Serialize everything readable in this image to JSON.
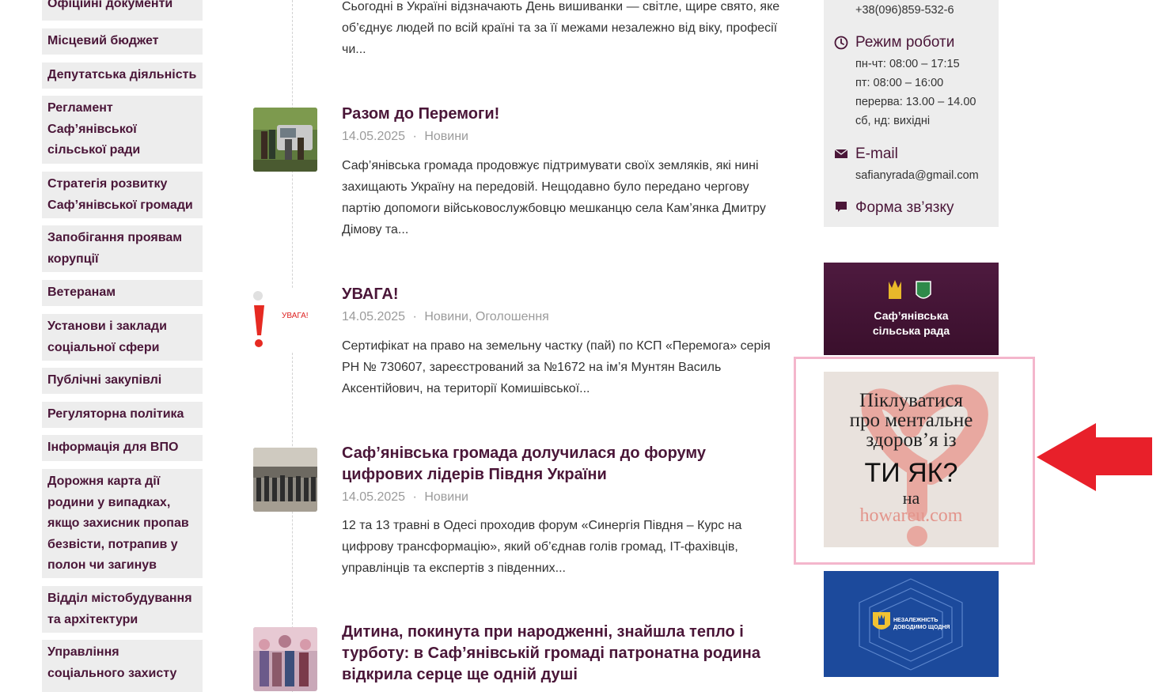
{
  "sidebar": {
    "items": [
      {
        "label": "Офіційні документи"
      },
      {
        "label": "Місцевий бюджет"
      },
      {
        "label": "Депутатська діяльність"
      },
      {
        "label": "Регламент Саф’янівської сільської ради"
      },
      {
        "label": "Стратегія розвитку Саф’янівської громади"
      },
      {
        "label": "Запобігання проявам корупції"
      },
      {
        "label": "Ветеранам"
      },
      {
        "label": "Установи і заклади соціальної сфери"
      },
      {
        "label": "Публічні закупівлі"
      },
      {
        "label": "Регуляторна політика"
      },
      {
        "label": "Інформація для ВПО"
      },
      {
        "label": "Дорожня карта дії родини у випадках, якщо захисник пропав безвісти, потрапив у полон чи загинув"
      },
      {
        "label": "Відділ містобудування та архітектури"
      },
      {
        "label": "Управління соціального захисту"
      }
    ]
  },
  "news": {
    "top_excerpt": "Сьогодні в Україні відзначають День вишиванки — світле, щире свято, яке об’єднує людей по всій країні та за її межами незалежно від віку, професії чи...",
    "items": [
      {
        "title": "Разом до Перемоги!",
        "date": "14.05.2025",
        "sep": "·",
        "categories": "Новини",
        "excerpt": "Саф’янівська громада продовжує підтримувати своїх земляків, які нині захищають Україну на передовій. Нещодавно було передано чергову партію допомоги військовослужбовцю мешканцю села Кам’янка Дмитру Дімову та..."
      },
      {
        "title": "УВАГА!",
        "date": "14.05.2025",
        "sep": "·",
        "categories": "Новини, Оголошення",
        "thumb_text": "УВАГА!",
        "excerpt": "Сертифікат на право на земельну частку (пай) по КСП «Перемога» серія РН № 730607, зареєстрований за №1672 на ім’я Мунтян Василь Аксентійович, на території Комишівської..."
      },
      {
        "title": "Саф’янівська громада долучилася до форуму цифрових лідерів Півдня України",
        "date": "14.05.2025",
        "sep": "·",
        "categories": "Новини",
        "excerpt": "12 та 13 травні в Одесі проходив форум «Синергія Півдня – Курс на цифрову трансформацію», який об’єднав голів громад, IT-фахівців, управлінців та експертів з південних..."
      },
      {
        "title": "Дитина, покинута при народженні, знайшла тепло і турботу: в Саф’янівській громаді патронатна родина відкрила серце ще одній душі"
      }
    ]
  },
  "contacts": {
    "phone": "+38(096)859-532-6",
    "hours_heading": "Режим роботи",
    "hours": [
      "пн-чт: 08:00 – 17:15",
      "пт: 08:00 – 16:00",
      "перерва: 13.00 – 14.00",
      "сб, нд: вихідні"
    ],
    "email_heading": "E-mail",
    "email": "safianyrada@gmail.com",
    "form_heading": "Форма зв’язку",
    "icons": {
      "hours": "clock-icon",
      "email": "envelope-icon",
      "form": "chat-bubble-icon"
    }
  },
  "banners": {
    "council": {
      "line1": "Саф’янівська",
      "line2": "сільська рада"
    },
    "mental": {
      "line1": "Піклуватися",
      "line2": "про ментальне",
      "line3": "здоров’я із",
      "line4": "ТИ ЯК?",
      "line5": "на",
      "line6": "howareu.com"
    },
    "independence": {
      "line1": "НЕЗАЛЕЖНІСТЬ",
      "line2": "ДОВОДИМО ЩОДНЯ"
    }
  },
  "colors": {
    "accent": "#4a1638",
    "sidebar_bg": "#ededed",
    "muted": "#9b9b9b",
    "highlight_frame": "#f4b6cc",
    "arrow": "#e8202a"
  }
}
